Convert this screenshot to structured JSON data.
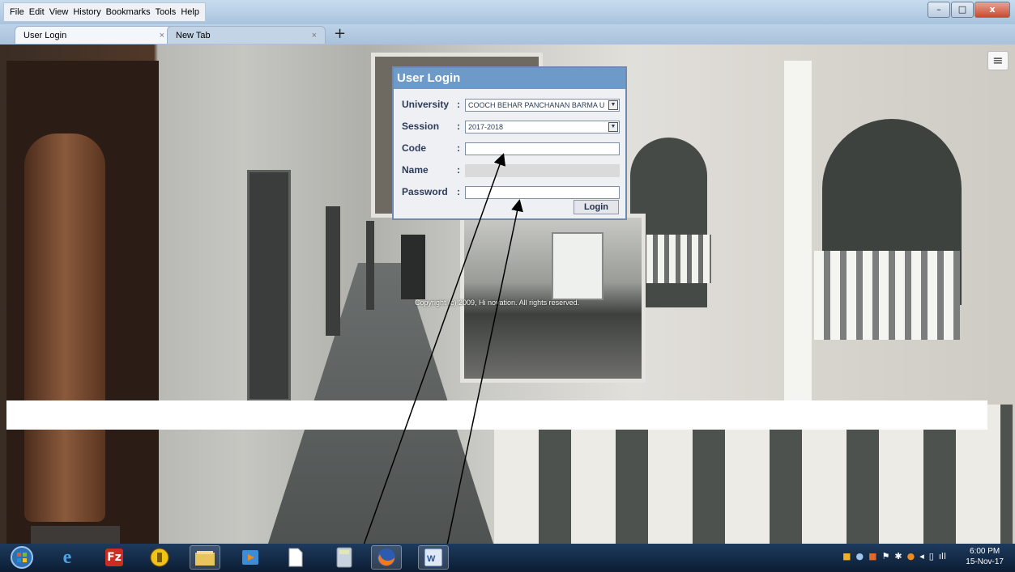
{
  "menu": {
    "file": "File",
    "edit": "Edit",
    "view": "View",
    "history": "History",
    "bookmarks": "Bookmarks",
    "tools": "Tools",
    "help": "Help"
  },
  "tabs": [
    {
      "label": "User Login",
      "close": "×"
    },
    {
      "label": "New Tab",
      "close": "×"
    }
  ],
  "new_tab_symbol": "+",
  "hamburger": "≡",
  "login": {
    "title": "User Login",
    "fields": {
      "university": {
        "label": "University",
        "colon": ":",
        "value": "COOCH BEHAR PANCHANAN BARMA U"
      },
      "session": {
        "label": "Session",
        "colon": ":",
        "value": "2017-2018"
      },
      "code": {
        "label": "Code",
        "colon": ":",
        "value": ""
      },
      "name": {
        "label": "Name",
        "colon": ":",
        "value": ""
      },
      "password": {
        "label": "Password",
        "colon": ":",
        "value": ""
      }
    },
    "button": "Login"
  },
  "copyright": "Copyright (c) 2009, Hi  novation. All rights reserved.",
  "taskbar": {
    "icons": [
      "start-orb-icon",
      "internet-explorer-icon",
      "filezilla-icon",
      "security-shield-icon",
      "file-explorer-icon",
      "media-player-icon",
      "blank-document-icon",
      "calculator-icon",
      "firefox-icon",
      "word-icon"
    ],
    "clock_time": "6:00 PM",
    "clock_date": "15-Nov-17"
  },
  "colors": {
    "login_header": "#6d9ac9",
    "login_border": "#6f8bad",
    "taskbar": "#0c1d33"
  }
}
